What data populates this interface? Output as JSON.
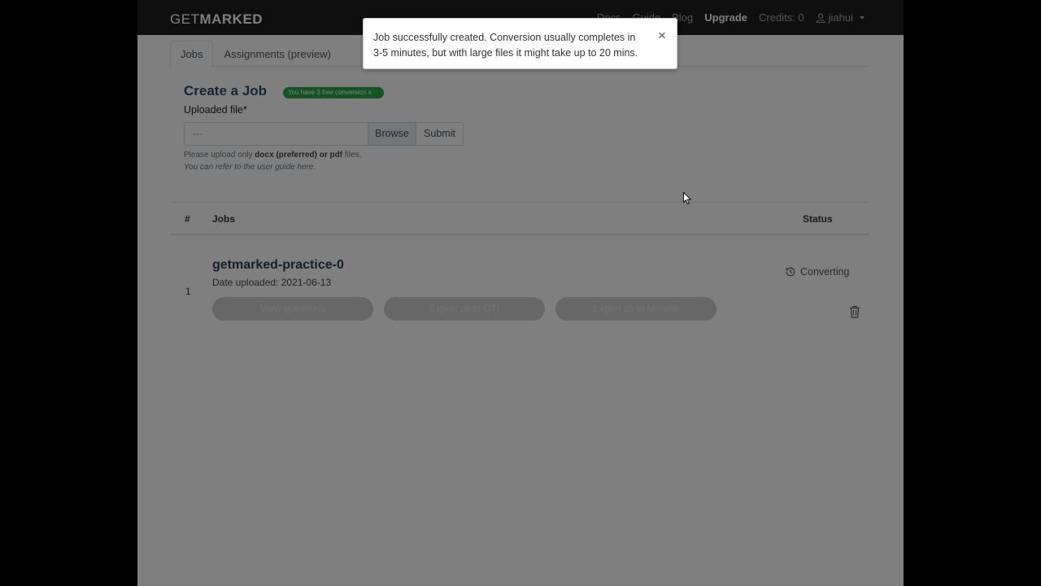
{
  "navbar": {
    "brand_light": "GET",
    "brand_bold": "MARKED",
    "links": [
      "Docs",
      "Guide",
      "Blog"
    ],
    "upgrade": "Upgrade",
    "credits": "Credits: 0",
    "username": "jiahui"
  },
  "tabs": [
    {
      "label": "Jobs",
      "active": true
    },
    {
      "label": "Assignments (preview)",
      "active": false
    }
  ],
  "create": {
    "title": "Create a Job",
    "badge": "You have 3 free conversion s",
    "file_label": "Uploaded file*",
    "file_value": "---",
    "browse_label": "Browse",
    "submit_label": "Submit",
    "help_prefix": "Please upload only ",
    "help_formats": "docx (preferred) or pdf",
    "help_suffix": " files.",
    "help_guide": "You can refer to the user guide here."
  },
  "table": {
    "col_num": "#",
    "col_jobs": "Jobs",
    "col_status": "Status",
    "rows": [
      {
        "num": "1",
        "name": "getmarked-practice-0",
        "date": "Date uploaded: 2021-06-13",
        "status": "Converting",
        "buttons": [
          "View questions",
          "Export all to QTI",
          "Export all to Moodle"
        ]
      }
    ]
  },
  "toast": {
    "message": "Job successfully created. Conversion usually completes in 3-5 minutes, but with large files it might take up to 20 mins.",
    "close": "×"
  },
  "colors": {
    "navbar_bg": "#1f1f1f",
    "badge_green": "#28a745",
    "title_navy": "#2a4a6b"
  }
}
